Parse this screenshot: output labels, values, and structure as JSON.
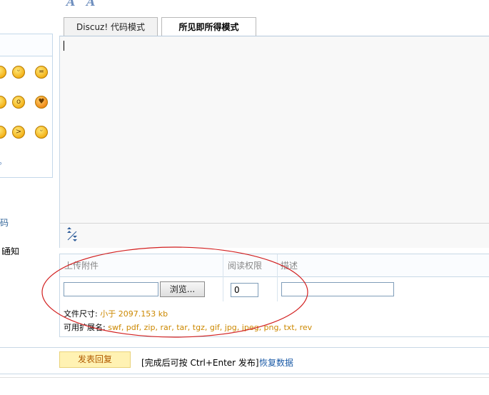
{
  "editor": {
    "tabs": [
      {
        "label": "Discuz! 代码模式"
      },
      {
        "label": "所见即所得模式"
      }
    ],
    "font_icons": [
      "A",
      "A"
    ]
  },
  "sidebar": {
    "more_link": "⌕",
    "link_code": "码",
    "notify_text": "通知",
    "smileys": [
      "smile-icon",
      "grin-icon",
      "tongue-icon",
      "confused-icon",
      "surprised-icon",
      "wink-heart-icon",
      "sweat-icon",
      "angry-icon",
      "happy-icon"
    ]
  },
  "attachments": {
    "col_upload": "上传附件",
    "col_permission": "阅读权限",
    "col_description": "描述",
    "browse_label": "浏览...",
    "permission_value": "0",
    "size_label": "文件尺寸:",
    "size_value": "小于  2097.153 kb",
    "ext_label": "可用扩展名:",
    "ext_value": "swf, pdf, zip, rar, tar, tgz, gif, jpg, jpeg, png, txt, rev"
  },
  "footer": {
    "submit_label": "发表回复",
    "hint": "[完成后可按 Ctrl+Enter 发布]",
    "restore_label": "恢复数据"
  },
  "colors": {
    "annotation": "#d21f1f",
    "link": "#1a5aa6",
    "orange_text": "#cc8800"
  }
}
